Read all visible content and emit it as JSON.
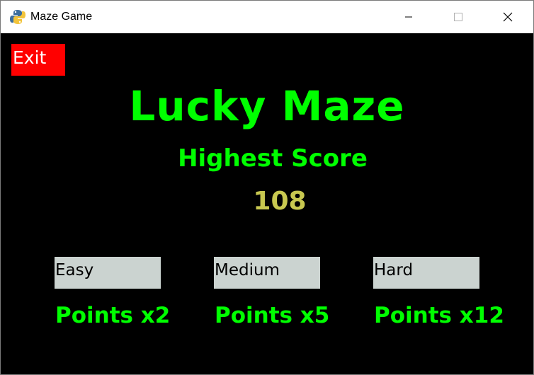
{
  "window": {
    "title": "Maze Game",
    "icon": "python-snake-icon",
    "controls": [
      "minimize-icon",
      "maximize-icon",
      "close-icon"
    ]
  },
  "game": {
    "exit_label": "Exit",
    "title": "Lucky Maze",
    "highest_score_label": "Highest Score",
    "highest_score": "108",
    "levels": [
      {
        "label": "Easy",
        "points": "Points x2"
      },
      {
        "label": "Medium",
        "points": "Points x5"
      },
      {
        "label": "Hard",
        "points": "Points x12"
      }
    ]
  },
  "colors": {
    "background": "#000000",
    "title_green": "#00ff00",
    "score_yellow": "#c8c850",
    "exit_red": "#ff0000",
    "level_button_gray": "#cbd3d0"
  }
}
